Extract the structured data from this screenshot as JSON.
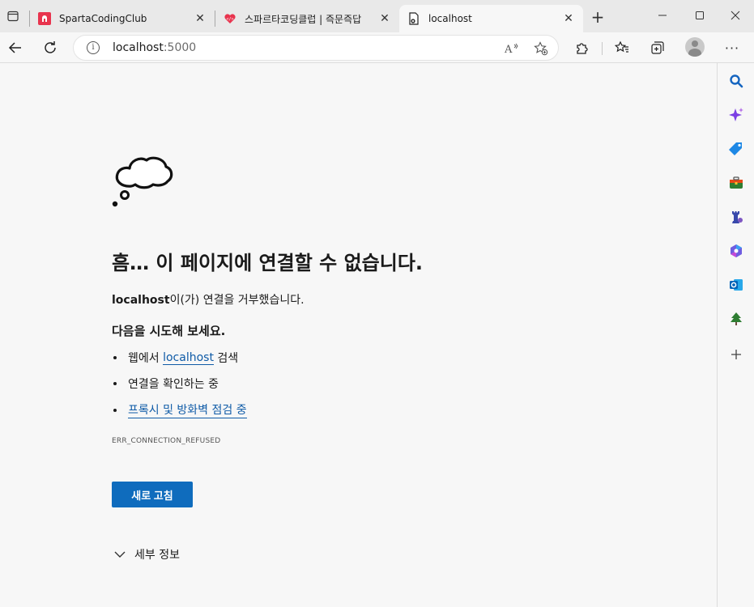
{
  "tabs": [
    {
      "title": "SpartaCodingClub",
      "favicon": "spartan-helmet-icon",
      "active": false
    },
    {
      "title": "스파르타코딩클럽 | 즉문즉답",
      "favicon": "heart-code-icon",
      "active": false
    },
    {
      "title": "localhost",
      "favicon": "page-error-icon",
      "active": true
    }
  ],
  "address_bar": {
    "host": "localhost",
    "port": ":5000"
  },
  "error": {
    "heading": "흠… 이 페이지에 연결할 수 없습니다.",
    "host": "localhost",
    "refused_text": "이(가) 연결을 거부했습니다.",
    "try_title": "다음을 시도해 보세요.",
    "suggestions": {
      "search_prefix": "웹에서 ",
      "search_link": "localhost",
      "search_suffix": " 검색",
      "check_connection": "연결을 확인하는 중",
      "proxy_firewall": "프록시 및 방화벽 점검 중"
    },
    "code": "ERR_CONNECTION_REFUSED",
    "reload_label": "새로 고침",
    "details_label": "세부 정보"
  },
  "colors": {
    "accent": "#0f6cbd",
    "link": "#0f5ba7",
    "background": "#f7f7f7"
  }
}
